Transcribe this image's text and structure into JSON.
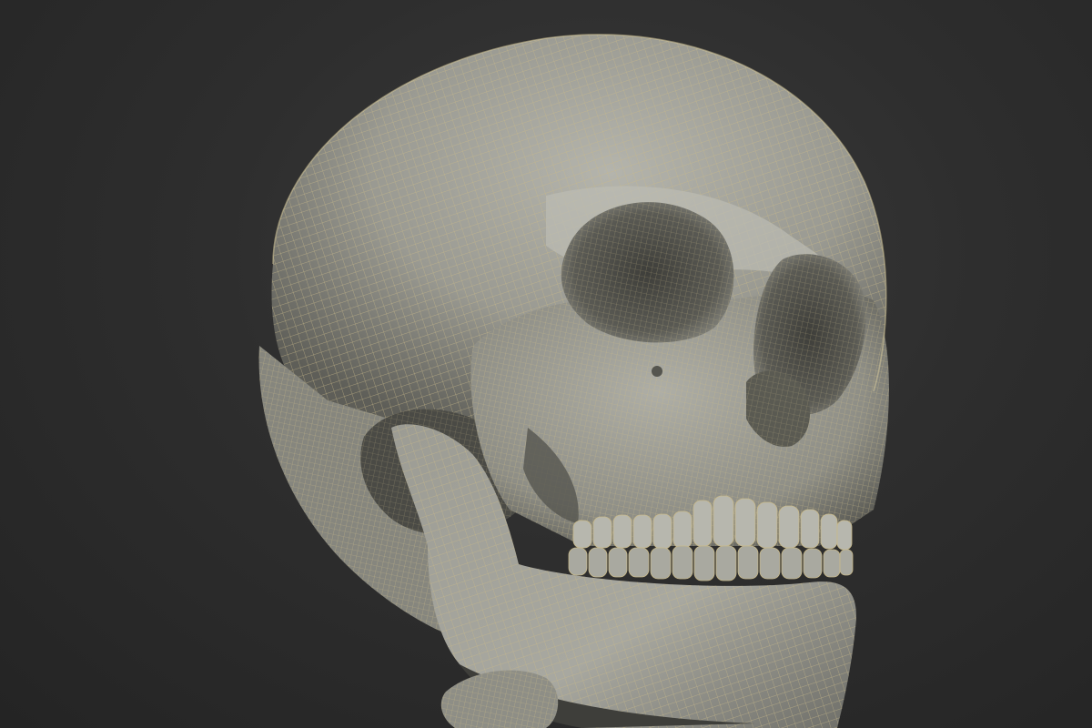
{
  "viewport": {
    "background": "#2b2b2b",
    "model_shade": "#9e9e96",
    "wire_color": "#c8b98a",
    "shadow_color": "#3a3a36"
  },
  "model": {
    "icon": "skull-mesh-icon",
    "render_mode": "smooth-shaded-with-wireframe"
  }
}
